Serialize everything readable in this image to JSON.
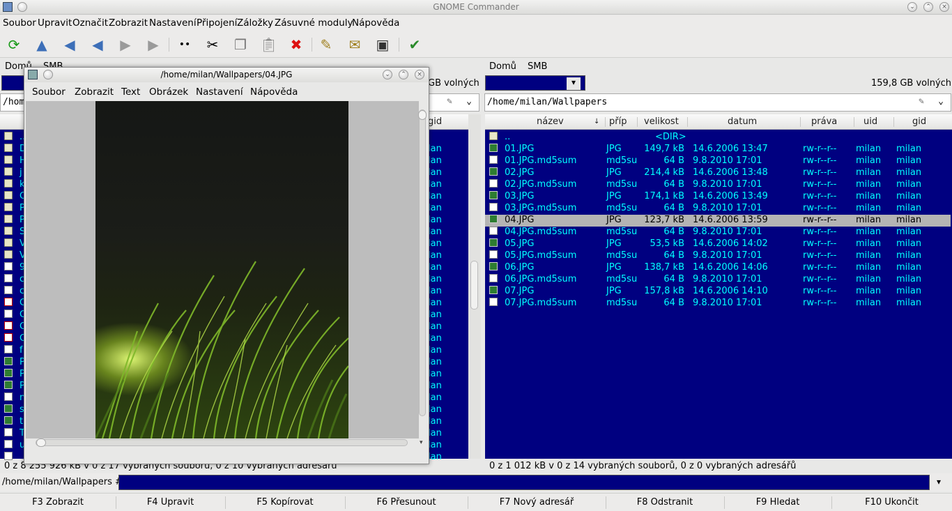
{
  "window": {
    "title": "GNOME Commander"
  },
  "menu": [
    "Soubor",
    "Upravit",
    "Označit",
    "Zobrazit",
    "Nastavení",
    "Připojení",
    "Záložky",
    "Zásuvné moduly",
    "Nápověda"
  ],
  "toolbar": {
    "icons": [
      "refresh-icon",
      "up-icon",
      "first-icon",
      "back-icon",
      "forward-icon",
      "last-icon",
      "dots-icon",
      "cut-icon",
      "copy-icon",
      "paste-icon",
      "delete-icon",
      "edit-icon",
      "mail-icon",
      "terminal-icon",
      "check-icon"
    ]
  },
  "left_panel": {
    "bookmarks": [
      "Domů",
      "SMB"
    ],
    "free_space": "GB volných",
    "path": "/home",
    "col_gid": "gid",
    "status": "0  z 8 255 926  kB v 0 z 17 vybraných souborů, 0 z 10 vybraných adresářů",
    "rows": [
      {
        "icon": "dir",
        "name": "..",
        "gid": ""
      },
      {
        "icon": "dir",
        "name": "D",
        "gid": "lan"
      },
      {
        "icon": "dir",
        "name": "H",
        "gid": "lan"
      },
      {
        "icon": "dir",
        "name": "j",
        "gid": "lan"
      },
      {
        "icon": "dir",
        "name": "k",
        "gid": "lan"
      },
      {
        "icon": "dir",
        "name": "O",
        "gid": "lan"
      },
      {
        "icon": "dir",
        "name": "P",
        "gid": "lan"
      },
      {
        "icon": "dir",
        "name": "P",
        "gid": "lan"
      },
      {
        "icon": "dir",
        "name": "S",
        "gid": "lan"
      },
      {
        "icon": "dir",
        "name": "V",
        "gid": "lan"
      },
      {
        "icon": "dir",
        "name": "V",
        "gid": "lan"
      },
      {
        "icon": "txt",
        "name": "9",
        "gid": "lan"
      },
      {
        "icon": "txt",
        "name": "c",
        "gid": "lan"
      },
      {
        "icon": "txt",
        "name": "c",
        "gid": "lan"
      },
      {
        "icon": "pdf",
        "name": "C",
        "gid": "lan"
      },
      {
        "icon": "txt",
        "name": "C",
        "gid": "lan"
      },
      {
        "icon": "pdf",
        "name": "C",
        "gid": "lan"
      },
      {
        "icon": "pdf",
        "name": "C",
        "gid": "lan"
      },
      {
        "icon": "txt",
        "name": "f",
        "gid": "lan"
      },
      {
        "icon": "img",
        "name": "P",
        "gid": "lan"
      },
      {
        "icon": "img",
        "name": "P",
        "gid": "lan"
      },
      {
        "icon": "img",
        "name": "P",
        "gid": "lan"
      },
      {
        "icon": "txt",
        "name": "n",
        "gid": "lan"
      },
      {
        "icon": "img",
        "name": "s",
        "gid": "lan"
      },
      {
        "icon": "img",
        "name": "t",
        "gid": "lan"
      },
      {
        "icon": "txt",
        "name": "T",
        "gid": "lan"
      },
      {
        "icon": "txt",
        "name": "u",
        "gid": "lan"
      },
      {
        "icon": "txt",
        "name": "",
        "gid": "lan"
      }
    ]
  },
  "right_panel": {
    "bookmarks": [
      "Domů",
      "SMB"
    ],
    "free_space": "159,8 GB volných",
    "path": "/home/milan/Wallpapers",
    "columns": [
      "název",
      "příp",
      "velikost",
      "datum",
      "práva",
      "uid",
      "gid"
    ],
    "status": "0  z 1 012  kB v 0 z 14 vybraných souborů, 0 z 0 vybraných adresářů",
    "rows": [
      {
        "icon": "dir",
        "name": "..",
        "ext": "",
        "size": "<DIR>",
        "date": "",
        "perm": "",
        "uid": "",
        "gid": ""
      },
      {
        "icon": "img",
        "name": "01.JPG",
        "ext": "JPG",
        "size": "149,7 kB",
        "date": "14.6.2006 13:47",
        "perm": "rw-r--r--",
        "uid": "milan",
        "gid": "milan"
      },
      {
        "icon": "txt",
        "name": "01.JPG.md5sum",
        "ext": "md5su",
        "size": "64 B",
        "date": "9.8.2010 17:01",
        "perm": "rw-r--r--",
        "uid": "milan",
        "gid": "milan"
      },
      {
        "icon": "img",
        "name": "02.JPG",
        "ext": "JPG",
        "size": "214,4 kB",
        "date": "14.6.2006 13:48",
        "perm": "rw-r--r--",
        "uid": "milan",
        "gid": "milan"
      },
      {
        "icon": "txt",
        "name": "02.JPG.md5sum",
        "ext": "md5su",
        "size": "64 B",
        "date": "9.8.2010 17:01",
        "perm": "rw-r--r--",
        "uid": "milan",
        "gid": "milan"
      },
      {
        "icon": "img",
        "name": "03.JPG",
        "ext": "JPG",
        "size": "174,1 kB",
        "date": "14.6.2006 13:49",
        "perm": "rw-r--r--",
        "uid": "milan",
        "gid": "milan"
      },
      {
        "icon": "txt",
        "name": "03.JPG.md5sum",
        "ext": "md5su",
        "size": "64 B",
        "date": "9.8.2010 17:01",
        "perm": "rw-r--r--",
        "uid": "milan",
        "gid": "milan"
      },
      {
        "icon": "img",
        "name": "04.JPG",
        "ext": "JPG",
        "size": "123,7 kB",
        "date": "14.6.2006 13:59",
        "perm": "rw-r--r--",
        "uid": "milan",
        "gid": "milan",
        "selected": true
      },
      {
        "icon": "txt",
        "name": "04.JPG.md5sum",
        "ext": "md5su",
        "size": "64 B",
        "date": "9.8.2010 17:01",
        "perm": "rw-r--r--",
        "uid": "milan",
        "gid": "milan"
      },
      {
        "icon": "img",
        "name": "05.JPG",
        "ext": "JPG",
        "size": "53,5 kB",
        "date": "14.6.2006 14:02",
        "perm": "rw-r--r--",
        "uid": "milan",
        "gid": "milan"
      },
      {
        "icon": "txt",
        "name": "05.JPG.md5sum",
        "ext": "md5su",
        "size": "64 B",
        "date": "9.8.2010 17:01",
        "perm": "rw-r--r--",
        "uid": "milan",
        "gid": "milan"
      },
      {
        "icon": "img",
        "name": "06.JPG",
        "ext": "JPG",
        "size": "138,7 kB",
        "date": "14.6.2006 14:06",
        "perm": "rw-r--r--",
        "uid": "milan",
        "gid": "milan"
      },
      {
        "icon": "txt",
        "name": "06.JPG.md5sum",
        "ext": "md5su",
        "size": "64 B",
        "date": "9.8.2010 17:01",
        "perm": "rw-r--r--",
        "uid": "milan",
        "gid": "milan"
      },
      {
        "icon": "img",
        "name": "07.JPG",
        "ext": "JPG",
        "size": "157,8 kB",
        "date": "14.6.2006 14:10",
        "perm": "rw-r--r--",
        "uid": "milan",
        "gid": "milan"
      },
      {
        "icon": "txt",
        "name": "07.JPG.md5sum",
        "ext": "md5su",
        "size": "64 B",
        "date": "9.8.2010 17:01",
        "perm": "rw-r--r--",
        "uid": "milan",
        "gid": "milan"
      }
    ]
  },
  "cmdline": {
    "prompt": "/home/milan/Wallpapers #"
  },
  "fkeys": [
    "F3 Zobrazit",
    "F4 Upravit",
    "F5 Kopírovat",
    "F6 Přesunout",
    "F7 Nový adresář",
    "F8 Odstranit",
    "F9 Hledat",
    "F10 Ukončit"
  ],
  "viewer": {
    "title": "/home/milan/Wallpapers/04.JPG",
    "menu": [
      "Soubor",
      "Zobrazit",
      "Text",
      "Obrázek",
      "Nastavení",
      "Nápověda"
    ]
  },
  "colors": {
    "panel_bg": "#000080",
    "file_text": "#00ffff",
    "selection": "#b4b4b4"
  }
}
